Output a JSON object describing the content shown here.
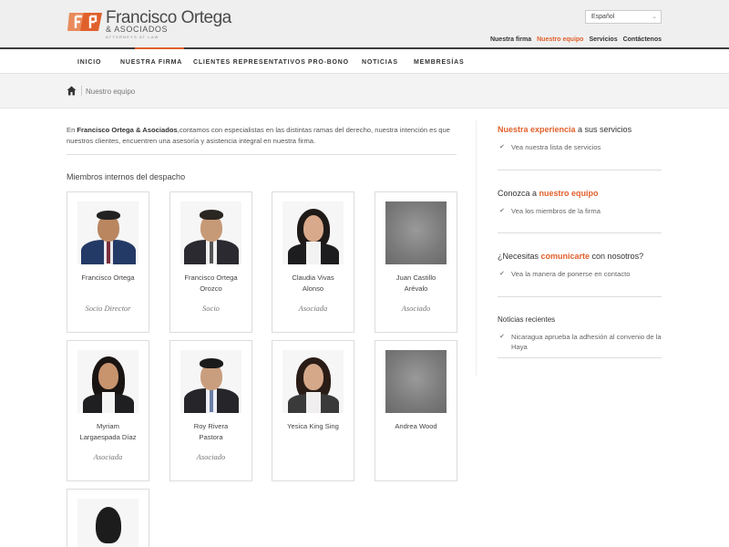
{
  "brand": {
    "name": "Francisco Ortega",
    "sub": "& ASOCIADOS",
    "tagline": "ATTORNEYS AT LAW",
    "accent": "#e0602c"
  },
  "language": {
    "selected": "Español"
  },
  "top_links": [
    "Nuestra firma",
    "Nuestro equipo",
    "Servicios",
    "Contáctenos"
  ],
  "top_links_active": "Nuestro equipo",
  "nav": {
    "items": [
      "INICIO",
      "NUESTRA FIRMA",
      "CLIENTES REPRESENTATIVOS",
      "PRO-BONO",
      "NOTICIAS",
      "MEMBRESÍAS"
    ]
  },
  "breadcrumb": {
    "current": "Nuestro equipo"
  },
  "intro": {
    "lead": "En ",
    "firm": "Francisco Ortega & Asociados",
    "rest": ",contamos con especialistas en las distintas ramas del derecho, nuestra intención es que nuestros clientes, encuentren una asesoría y asistencia integral en nuestra firma."
  },
  "section_title": "Miembros internos del despacho",
  "members": [
    {
      "name_line1": "Francisco Ortega",
      "name_line2": "",
      "role": "Socio Director"
    },
    {
      "name_line1": "Francisco Ortega",
      "name_line2": "Orozco",
      "role": "Socio"
    },
    {
      "name_line1": "Claudia Vivas",
      "name_line2": "Alonso",
      "role": "Asociada"
    },
    {
      "name_line1": "Juan Castillo",
      "name_line2": "Arévalo",
      "role": "Asociado"
    },
    {
      "name_line1": "Myriam",
      "name_line2": "Largaespada Díaz",
      "role": "Asociada"
    },
    {
      "name_line1": "Roy Rivera",
      "name_line2": "Pastora",
      "role": "Asociado"
    },
    {
      "name_line1": "Yesica King Sing",
      "name_line2": "",
      "role": ""
    },
    {
      "name_line1": "Andrea Wood",
      "name_line2": "",
      "role": ""
    }
  ],
  "sidebar": {
    "block1": {
      "hl": "Nuestra experiencia",
      "rest": " a sus servicios",
      "link": "Vea nuestra lista de servicios"
    },
    "block2": {
      "pre": "Conozca a ",
      "hl": "nuestro equipo",
      "link": "Vea los miembros de la firma"
    },
    "block3": {
      "pre": "¿Necesitas ",
      "hl": "comunicarte",
      "rest": " con nosotros?",
      "link": "Vea la manera de ponerse en contacto"
    },
    "news": {
      "title": "Noticias recientes",
      "link": "Nicaragua aprueba la adhesión al convenio de la Haya"
    }
  }
}
